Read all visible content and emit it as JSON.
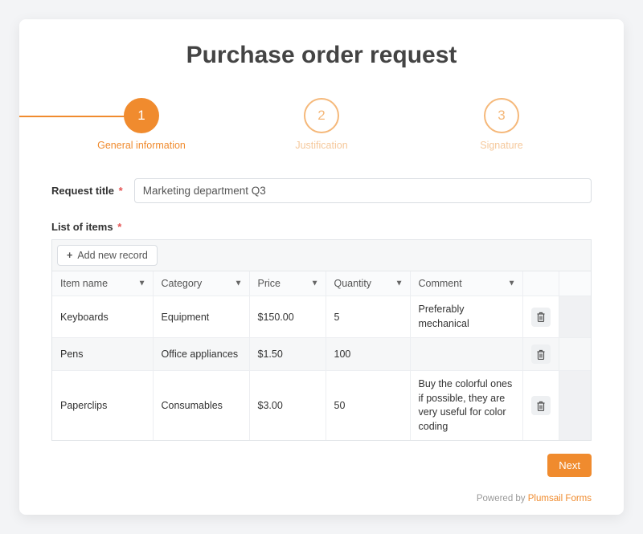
{
  "title": "Purchase order request",
  "steps": [
    {
      "num": "1",
      "label": "General information",
      "active": true
    },
    {
      "num": "2",
      "label": "Justification",
      "active": false
    },
    {
      "num": "3",
      "label": "Signature",
      "active": false
    }
  ],
  "fields": {
    "request_title_label": "Request title",
    "request_title_value": "Marketing department Q3",
    "list_of_items_label": "List of items"
  },
  "table": {
    "add_record_label": "Add new record",
    "columns": {
      "item": "Item name",
      "category": "Category",
      "price": "Price",
      "quantity": "Quantity",
      "comment": "Comment"
    },
    "rows": [
      {
        "item": "Keyboards",
        "category": "Equipment",
        "price": "$150.00",
        "quantity": "5",
        "comment": "Preferably mechanical"
      },
      {
        "item": "Pens",
        "category": "Office appliances",
        "price": "$1.50",
        "quantity": "100",
        "comment": ""
      },
      {
        "item": "Paperclips",
        "category": "Consumables",
        "price": "$3.00",
        "quantity": "50",
        "comment": "Buy the colorful ones if possible, they are very useful for color coding"
      }
    ]
  },
  "actions": {
    "next": "Next"
  },
  "footer": {
    "powered_by": "Powered by ",
    "link": "Plumsail Forms"
  }
}
